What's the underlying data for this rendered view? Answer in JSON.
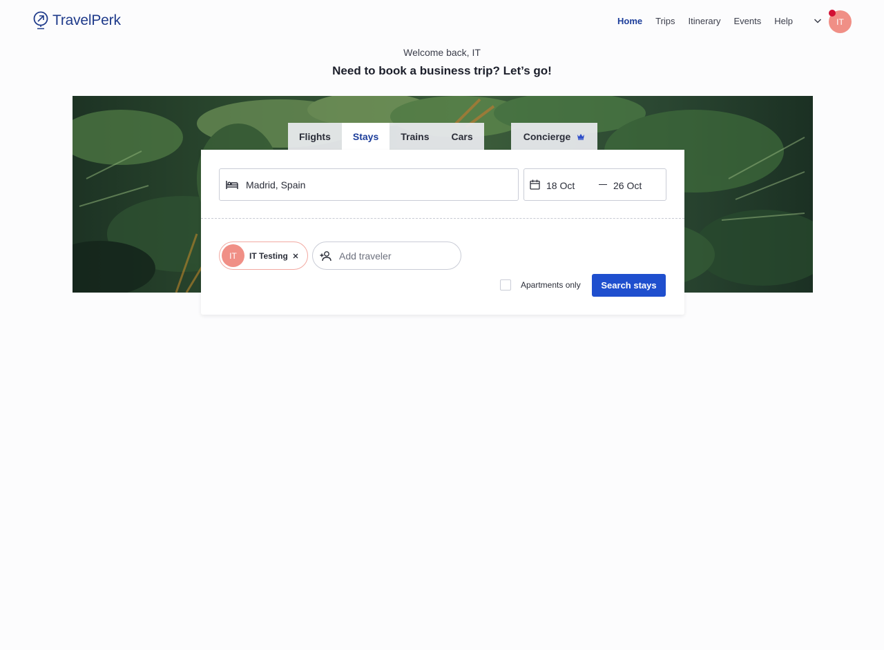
{
  "brand": {
    "name": "TravelPerk"
  },
  "nav": {
    "items": [
      {
        "label": "Home",
        "active": true
      },
      {
        "label": "Trips"
      },
      {
        "label": "Itinerary"
      },
      {
        "label": "Events"
      },
      {
        "label": "Help"
      }
    ]
  },
  "user": {
    "initials": "IT"
  },
  "greeting": {
    "welcome": "Welcome back, IT",
    "headline": "Need to book a business trip? Let’s go!"
  },
  "tabs": [
    {
      "label": "Flights"
    },
    {
      "label": "Stays",
      "active": true
    },
    {
      "label": "Trains"
    },
    {
      "label": "Cars"
    }
  ],
  "concierge": {
    "label": "Concierge"
  },
  "search": {
    "destination": "Madrid, Spain",
    "check_in": "18 Oct",
    "check_out": "26 Oct"
  },
  "travelers": {
    "selected": [
      {
        "initials": "IT",
        "name": "IT Testing"
      }
    ],
    "add_placeholder": "Add traveler"
  },
  "options": {
    "apartments_only_label": "Apartments only",
    "apartments_only_checked": false
  },
  "actions": {
    "search_label": "Search stays"
  },
  "colors": {
    "brand_blue": "#1c3d9a",
    "primary_button": "#1f4fce",
    "avatar": "#f08f86",
    "notification": "#d21034"
  }
}
